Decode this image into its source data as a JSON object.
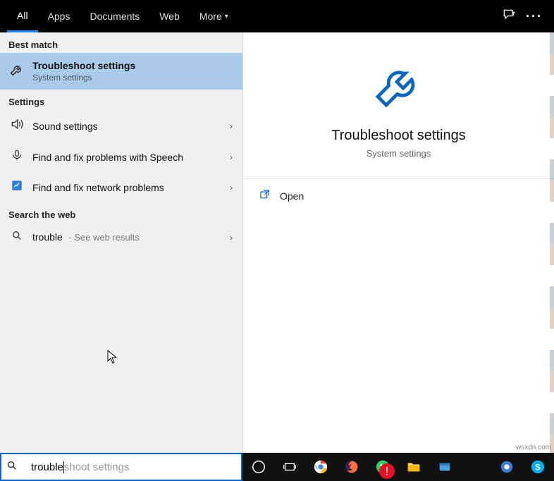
{
  "tabs": {
    "all": "All",
    "apps": "Apps",
    "documents": "Documents",
    "web": "Web",
    "more": "More"
  },
  "sections": {
    "best_match": "Best match",
    "settings": "Settings",
    "search_web": "Search the web"
  },
  "best_match": {
    "title": "Troubleshoot settings",
    "subtitle": "System settings"
  },
  "settings_items": [
    {
      "icon": "sound",
      "label": "Sound settings"
    },
    {
      "icon": "speech",
      "label": "Find and fix problems with Speech"
    },
    {
      "icon": "network",
      "label": "Find and fix network problems"
    }
  ],
  "web_search": {
    "query": "trouble",
    "hint": "- See web results"
  },
  "detail": {
    "title": "Troubleshoot settings",
    "subtitle": "System settings",
    "actions": {
      "open": "Open"
    }
  },
  "search": {
    "typed": "trouble",
    "ghost": "shoot settings",
    "full_placeholder": "troubleshoot settings"
  },
  "watermark": "wsxdn.com"
}
